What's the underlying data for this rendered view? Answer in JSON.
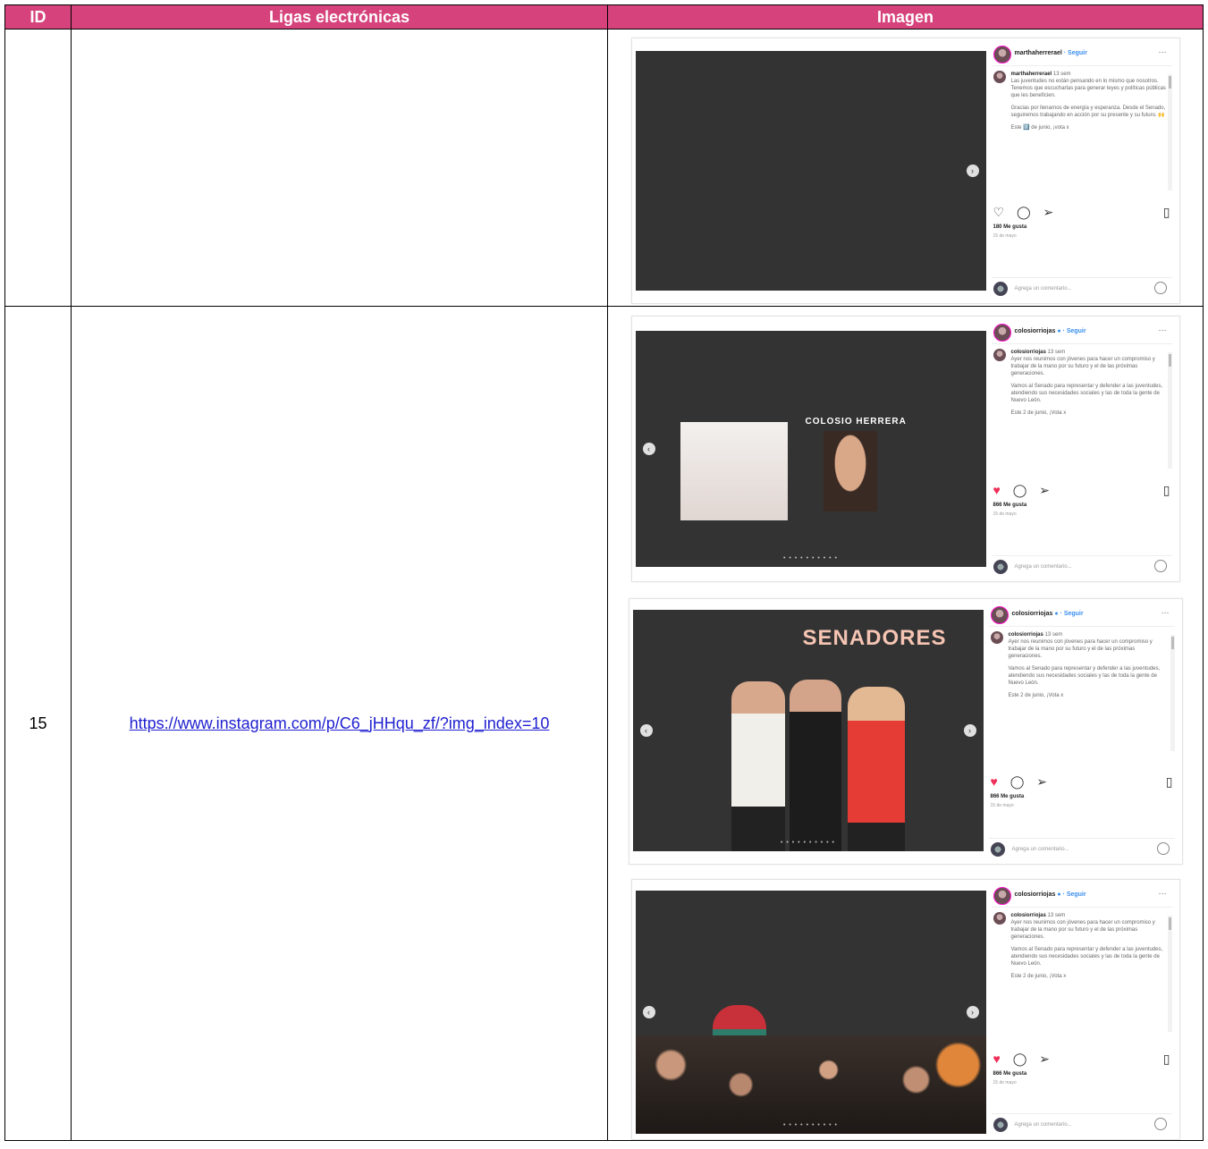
{
  "table": {
    "headers": [
      "ID",
      "Ligas electrónicas",
      "Imagen"
    ],
    "rows": [
      {
        "id": "",
        "link": ""
      },
      {
        "id": "15",
        "link": "https://www.instagram.com/p/C6_jHHqu_zf/?img_index=10"
      }
    ]
  },
  "posts": [
    {
      "username": "marthaherrerael",
      "follow": "· Seguir",
      "more": "···",
      "caption_user": "marthaherrerael",
      "caption_time": "13 sem",
      "caption": [
        "Las juventudes no están pensando en lo mismo que nosotros. Tenemos que escucharlas para generar leyes y políticas públicas que les beneficien.",
        "Gracias por llenarnos de energía y esperanza. Desde el Senado, seguiremos trabajando en acción por su presente y su futuro. 🙌",
        "Este 2️⃣ de junio, ¡vota x"
      ],
      "likes": "180 Me gusta",
      "date": "15 de mayo",
      "comment_placeholder": "Agrega un comentario...",
      "dots": "",
      "liked": false
    },
    {
      "username": "colosiorriojas",
      "follow": "· Seguir",
      "more": "···",
      "caption_user": "colosiorriojas",
      "caption_time": "13 sem",
      "caption": [
        "Ayer nos reunimos con jóvenes para hacer un compromiso y trabajar de la mano por su futuro y el de las próximas generaciones.",
        "Vamos al Senado para representar y defender a las juventudes, atendiendo sus necesidades sociales y las de toda la gente de Nuevo León.",
        "Este 2 de junio, ¡Vota x"
      ],
      "likes": "866 Me gusta",
      "date": "15 de mayo",
      "comment_placeholder": "Agrega un comentario...",
      "stage_text": "COLOSIO HERRERA",
      "dots": "• • • • • • • • • •",
      "liked": true
    },
    {
      "username": "colosiorriojas",
      "follow": "· Seguir",
      "more": "···",
      "caption_user": "colosiorriojas",
      "caption_time": "13 sem",
      "caption": [
        "Ayer nos reunimos con jóvenes para hacer un compromiso y trabajar de la mano por su futuro y el de las próximas generaciones.",
        "Vamos al Senado para representar y defender a las juventudes, atendiendo sus necesidades sociales y las de toda la gente de Nuevo León.",
        "Este 2 de junio, ¡Vota x"
      ],
      "likes": "866 Me gusta",
      "date": "15 de mayo",
      "comment_placeholder": "Agrega un comentario...",
      "banner": "SENADORES",
      "dots": "• • • • • • • • • •",
      "liked": true
    },
    {
      "username": "colosiorriojas",
      "follow": "· Seguir",
      "more": "···",
      "caption_user": "colosiorriojas",
      "caption_time": "13 sem",
      "caption": [
        "Ayer nos reunimos con jóvenes para hacer un compromiso y trabajar de la mano por su futuro y el de las próximas generaciones.",
        "Vamos al Senado para representar y defender a las juventudes, atendiendo sus necesidades sociales y las de toda la gente de Nuevo León.",
        "Este 2 de junio, ¡Vota x"
      ],
      "likes": "866 Me gusta",
      "date": "15 de mayo",
      "comment_placeholder": "Agrega un comentario...",
      "dots": "• • • • • • • • • •",
      "liked": true
    }
  ]
}
